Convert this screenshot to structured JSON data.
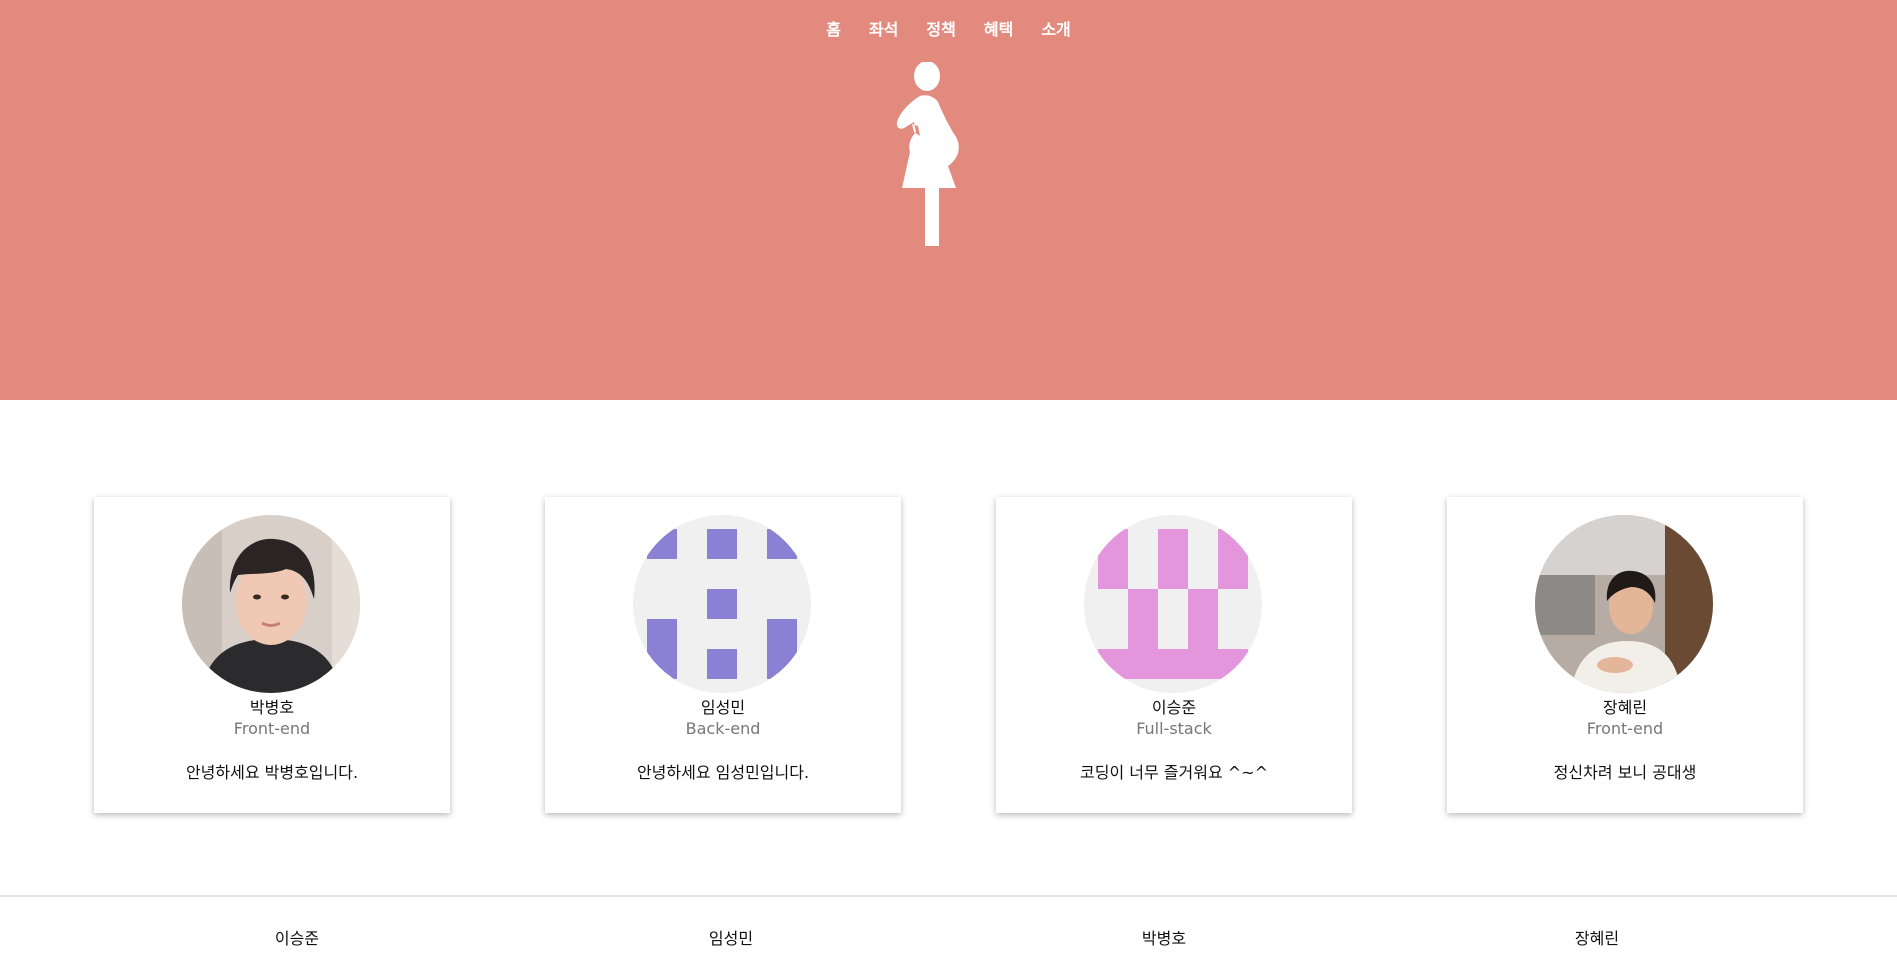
{
  "nav": {
    "items": [
      "홈",
      "좌석",
      "정책",
      "혜택",
      "소개"
    ]
  },
  "colors": {
    "hero_bg": "#e28a7e",
    "identicon_purple": "#8a80d4",
    "identicon_pink": "#e496dc"
  },
  "logo": {
    "icon": "pregnant-woman-icon"
  },
  "cards": [
    {
      "name": "박병호",
      "role": "Front-end",
      "intro": "안녕하세요 박병호입니다.",
      "avatar": "photo"
    },
    {
      "name": "임성민",
      "role": "Back-end",
      "intro": "안녕하세요 임성민입니다.",
      "avatar": "identicon"
    },
    {
      "name": "이승준",
      "role": "Full-stack",
      "intro": "코딩이 너무 즐거워요 ^~^",
      "avatar": "identicon"
    },
    {
      "name": "장혜린",
      "role": "Front-end",
      "intro": "정신차려 보니 공대생",
      "avatar": "photo"
    }
  ],
  "footer": {
    "names": [
      "이승준",
      "임성민",
      "박병호",
      "장혜린"
    ]
  }
}
